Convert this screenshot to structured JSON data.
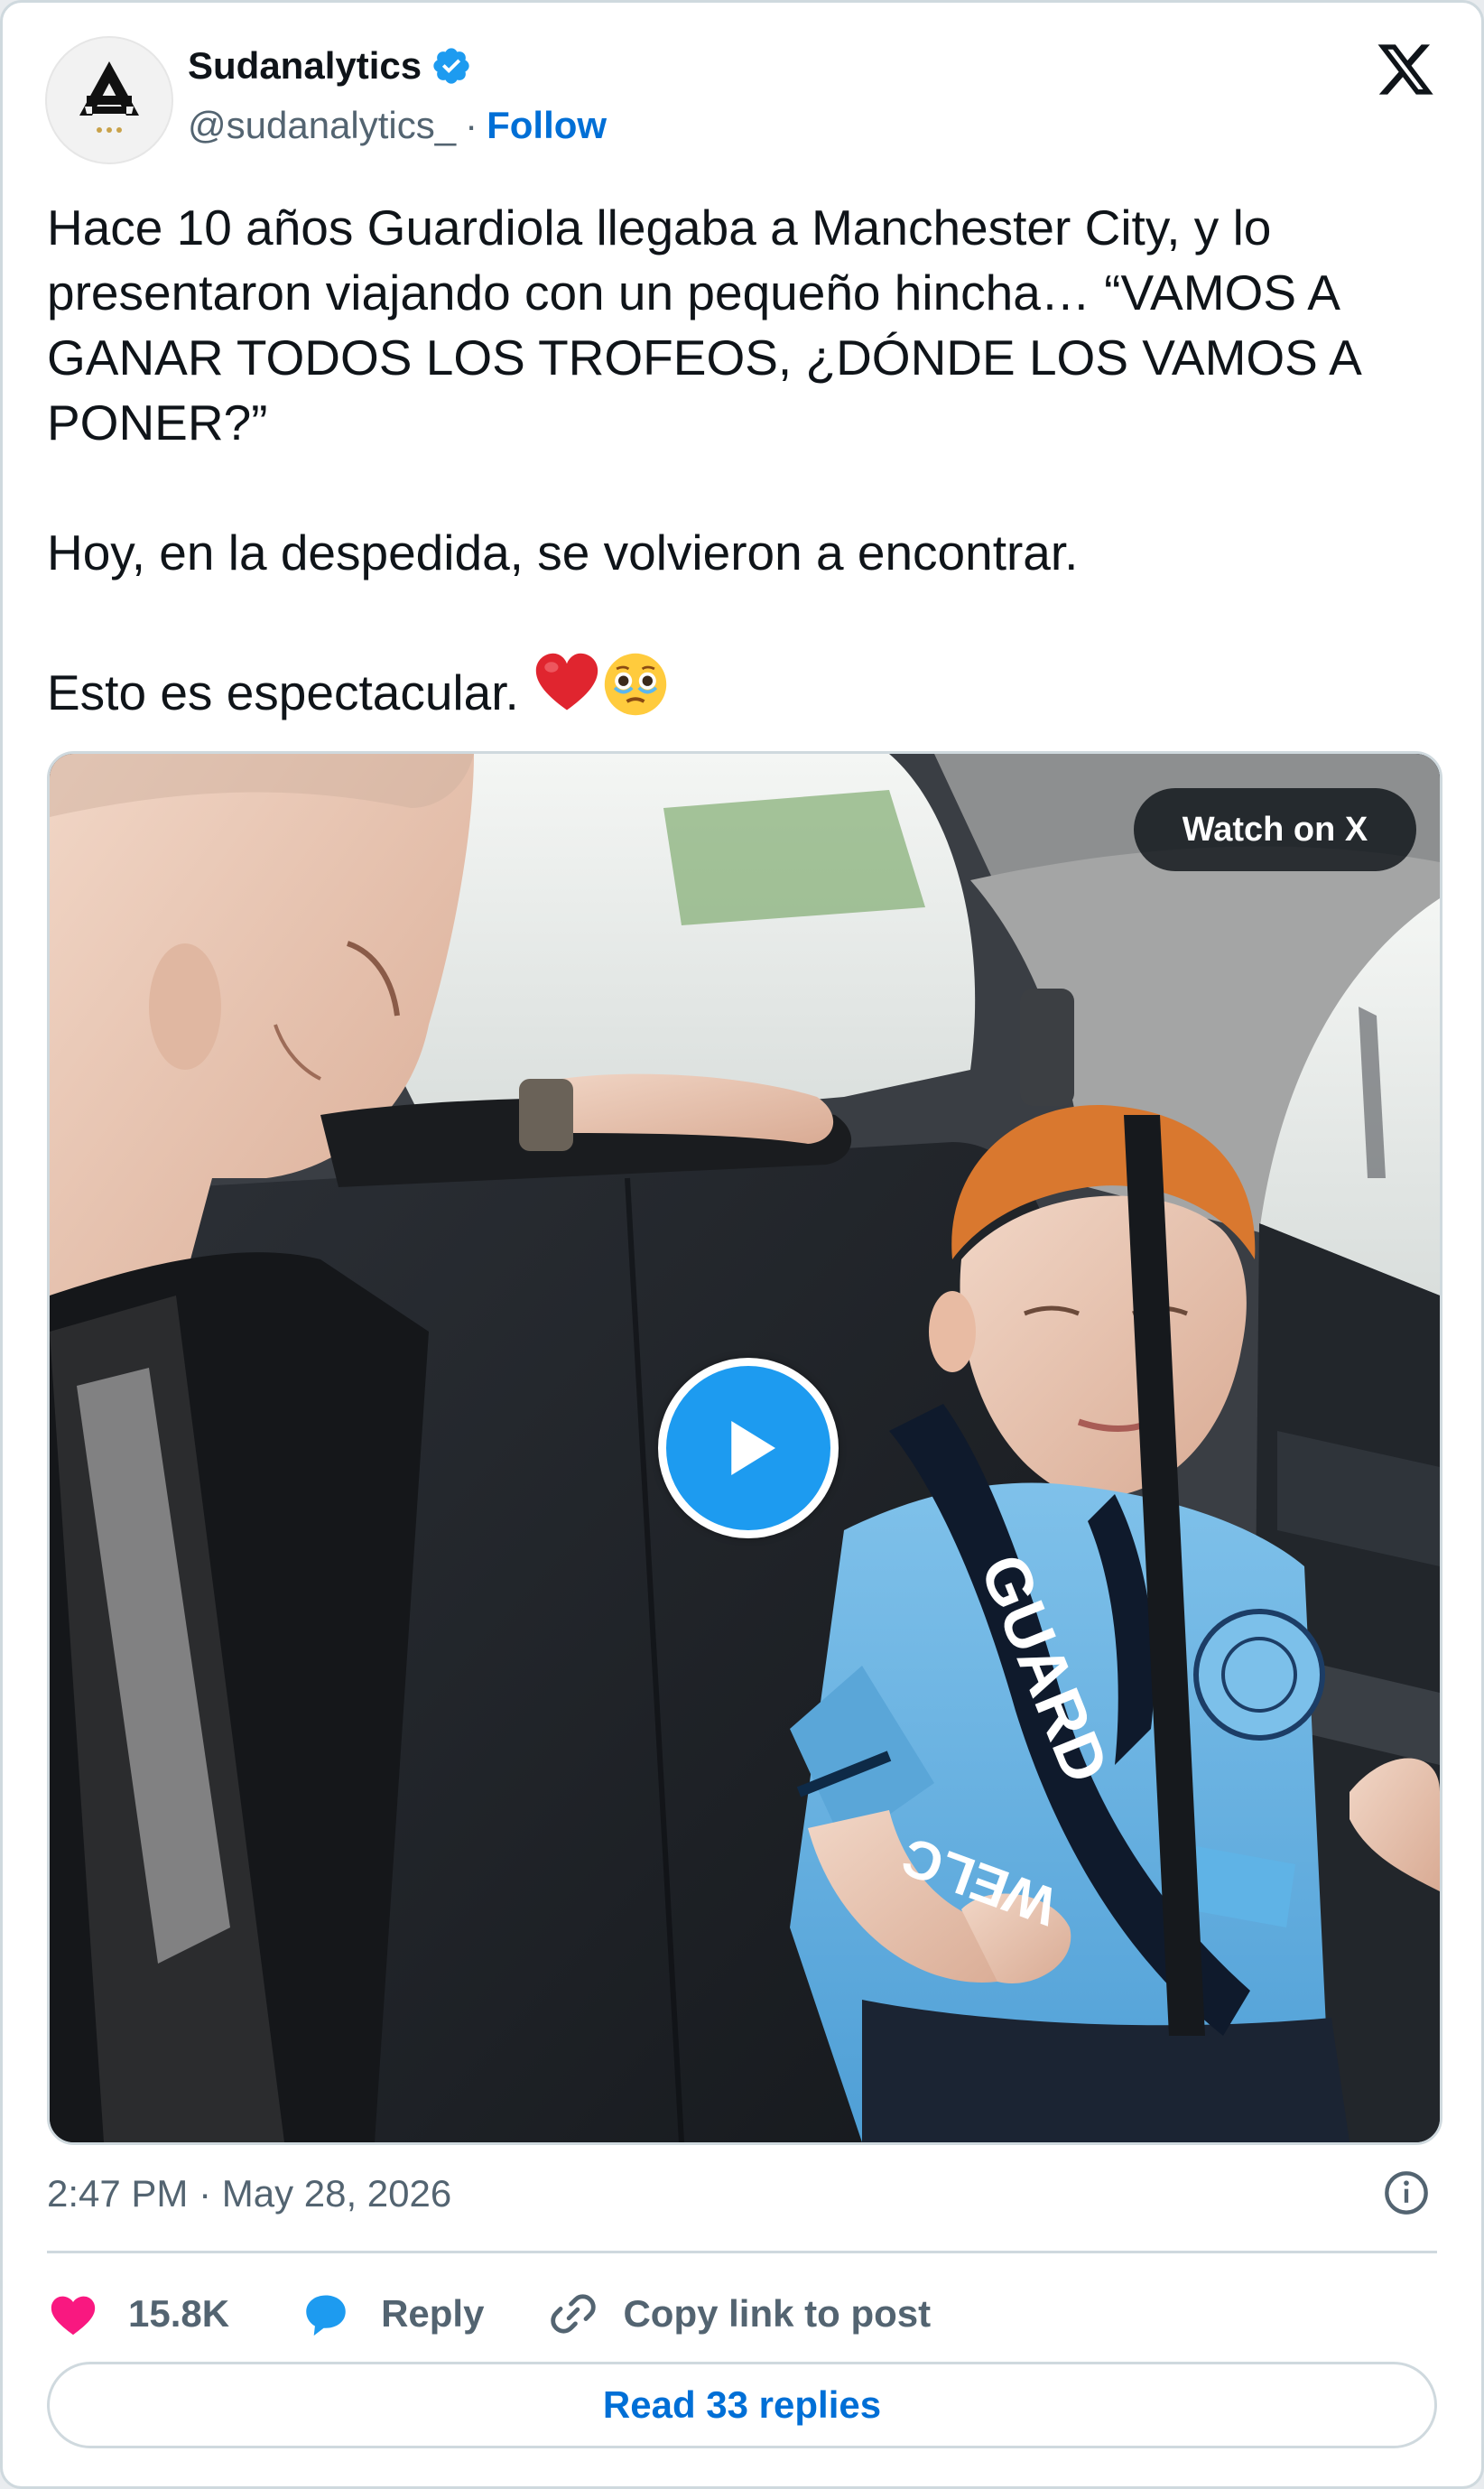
{
  "author": {
    "display_name": "Sudanalytics",
    "handle": "@sudanalytics_",
    "separator": "·",
    "follow_label": "Follow",
    "verified": true
  },
  "tweet": {
    "paragraph_1": "Hace 10 años Guardiola llegaba a Manchester City, y lo presentaron viajando con un pequeño hincha… “VAMOS A GANAR TODOS LOS TROFEOS, ¿DÓNDE LOS VAMOS A PONER?”",
    "paragraph_2": "Hoy, en la despedida, se volvieron a encontrar.",
    "paragraph_3": "Esto es espectacular.",
    "emojis": [
      "red-heart",
      "face-holding-back-tears"
    ]
  },
  "media": {
    "watch_label": "Watch on X",
    "scarf_text": "WELCOME GUARDIOLA"
  },
  "footer": {
    "timestamp": "2:47 PM · May 28, 2026",
    "likes": "15.8K",
    "reply_label": "Reply",
    "copy_label": "Copy link to post",
    "read_replies_label": "Read 33 replies"
  },
  "colors": {
    "link_blue": "#006fd6",
    "verified_blue": "#1d9bf0",
    "like_pink": "#f91880",
    "muted": "#536471"
  }
}
